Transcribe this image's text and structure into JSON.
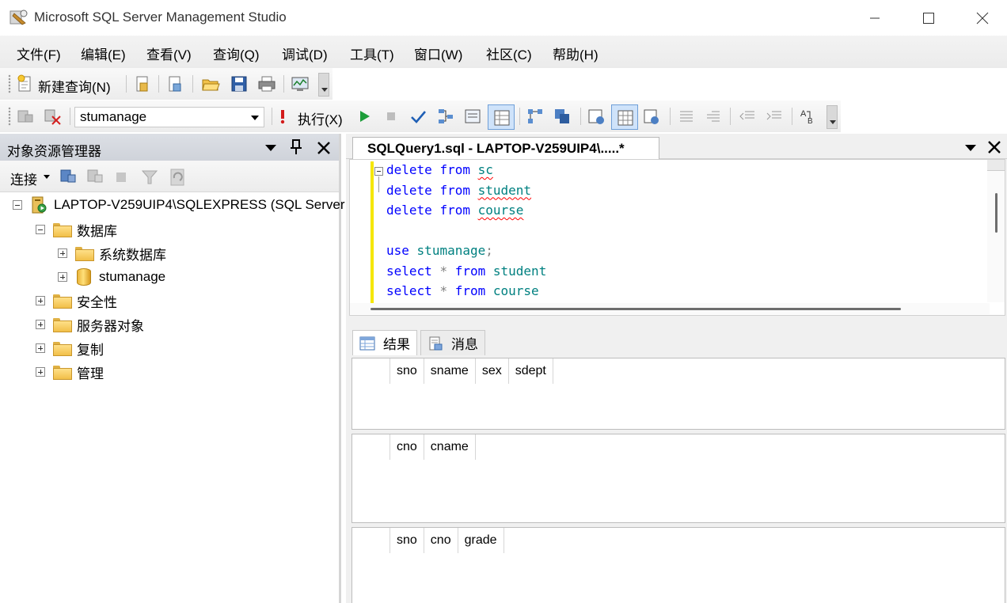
{
  "window": {
    "title": "Microsoft SQL Server Management Studio",
    "controls": {
      "minimize": "—",
      "maximize": "☐",
      "close": "✕"
    }
  },
  "menu": [
    "文件(F)",
    "编辑(E)",
    "查看(V)",
    "查询(Q)",
    "调试(D)",
    "工具(T)",
    "窗口(W)",
    "社区(C)",
    "帮助(H)"
  ],
  "toolbar1": {
    "new_query": "新建查询(N)"
  },
  "toolbar2": {
    "database": "stumanage",
    "execute": "执行(X)"
  },
  "object_explorer": {
    "title": "对象资源管理器",
    "connect": "连接",
    "tree": [
      {
        "label": "LAPTOP-V259UIP4\\SQLEXPRESS (SQL Server",
        "level": 0,
        "icon": "server-icon",
        "expander": "minus"
      },
      {
        "label": "数据库",
        "level": 1,
        "icon": "folder-icon",
        "expander": "minus"
      },
      {
        "label": "系统数据库",
        "level": 2,
        "icon": "folder-icon",
        "expander": "plus"
      },
      {
        "label": "stumanage",
        "level": 2,
        "icon": "database-icon",
        "expander": "plus"
      },
      {
        "label": "安全性",
        "level": 1,
        "icon": "folder-icon",
        "expander": "plus"
      },
      {
        "label": "服务器对象",
        "level": 1,
        "icon": "folder-icon",
        "expander": "plus"
      },
      {
        "label": "复制",
        "level": 1,
        "icon": "folder-icon",
        "expander": "plus"
      },
      {
        "label": "管理",
        "level": 1,
        "icon": "folder-icon",
        "expander": "plus"
      }
    ]
  },
  "document": {
    "tab_title": "SQLQuery1.sql - LAPTOP-V259UIP4\\.....*",
    "code": {
      "line1": {
        "kw1": "delete",
        "kw2": "from",
        "id": "sc"
      },
      "line2": {
        "kw1": "delete",
        "kw2": "from",
        "id": "student"
      },
      "line3": {
        "kw1": "delete",
        "kw2": "from",
        "id": "course"
      },
      "line5": {
        "kw": "use",
        "id": "stumanage",
        "punct": ";"
      },
      "line6": {
        "kw1": "select",
        "op": "*",
        "kw2": "from",
        "id": "student"
      },
      "line7": {
        "kw1": "select",
        "op": "*",
        "kw2": "from",
        "id": "course"
      }
    }
  },
  "results": {
    "tabs": {
      "results": "结果",
      "messages": "消息"
    },
    "grids": [
      {
        "columns": [
          "sno",
          "sname",
          "sex",
          "sdept"
        ]
      },
      {
        "columns": [
          "cno",
          "cname"
        ]
      },
      {
        "columns": [
          "sno",
          "cno",
          "grade"
        ]
      }
    ]
  },
  "colors": {
    "keyword": "#0000ff",
    "identifier": "#008080",
    "operator": "#808080",
    "change_margin": "#f5e600",
    "panel_header": "#d5d9e0"
  }
}
